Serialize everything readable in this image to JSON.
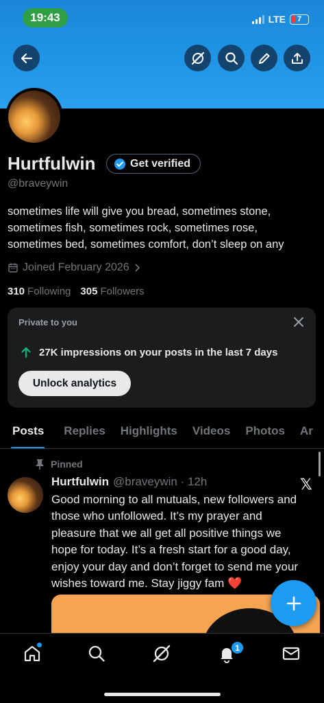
{
  "status_bar": {
    "time": "19:43",
    "network": "LTE",
    "battery": "7"
  },
  "header": {
    "icons": [
      "back-arrow-icon",
      "grok-icon",
      "search-icon",
      "edit-pencil-icon",
      "share-icon"
    ]
  },
  "profile": {
    "name": "Hurtfulwin",
    "verify_label": "Get verified",
    "handle": "@braveywin",
    "bio_lines": [
      "sometimes life will give you bread, sometimes stone,",
      "sometimes fish, sometimes rock, sometimes rose,",
      "sometimes bed, sometimes comfort, don’t sleep on any"
    ],
    "joined": "Joined February 2026",
    "following_count": "310",
    "following_label": "Following",
    "followers_count": "305",
    "followers_label": "Followers"
  },
  "analytics_card": {
    "private_label": "Private to you",
    "impressions_text": "27K impressions on your posts in the last 7 days",
    "unlock_label": "Unlock analytics"
  },
  "tabs": [
    "Posts",
    "Replies",
    "Highlights",
    "Videos",
    "Photos",
    "Ar"
  ],
  "active_tab": "Posts",
  "post": {
    "pinned_label": "Pinned",
    "author": "Hurtfulwin",
    "meta": "@braveywin · 12h",
    "text_lines": [
      "Good morning to all mutuals, new followers and",
      "those who unfollowed. It’s my prayer and",
      "pleasure that we all get all positive things we",
      "hope for today.  It’s a fresh start for a good day,",
      "enjoy your day and don’t forget to send me your",
      "wishes toward me. Stay jiggy fam ❤️"
    ],
    "x_logo": "𝕏"
  },
  "bottom_nav": {
    "items": [
      "home-icon",
      "search-icon",
      "grok-icon",
      "notifications-icon",
      "messages-icon"
    ],
    "notification_badge": "1"
  },
  "colors": {
    "accent": "#1d9bf0",
    "banner": "#1a86d8",
    "background": "#000000",
    "muted_text": "#71767b",
    "impressions_arrow": "#00ba7c"
  }
}
